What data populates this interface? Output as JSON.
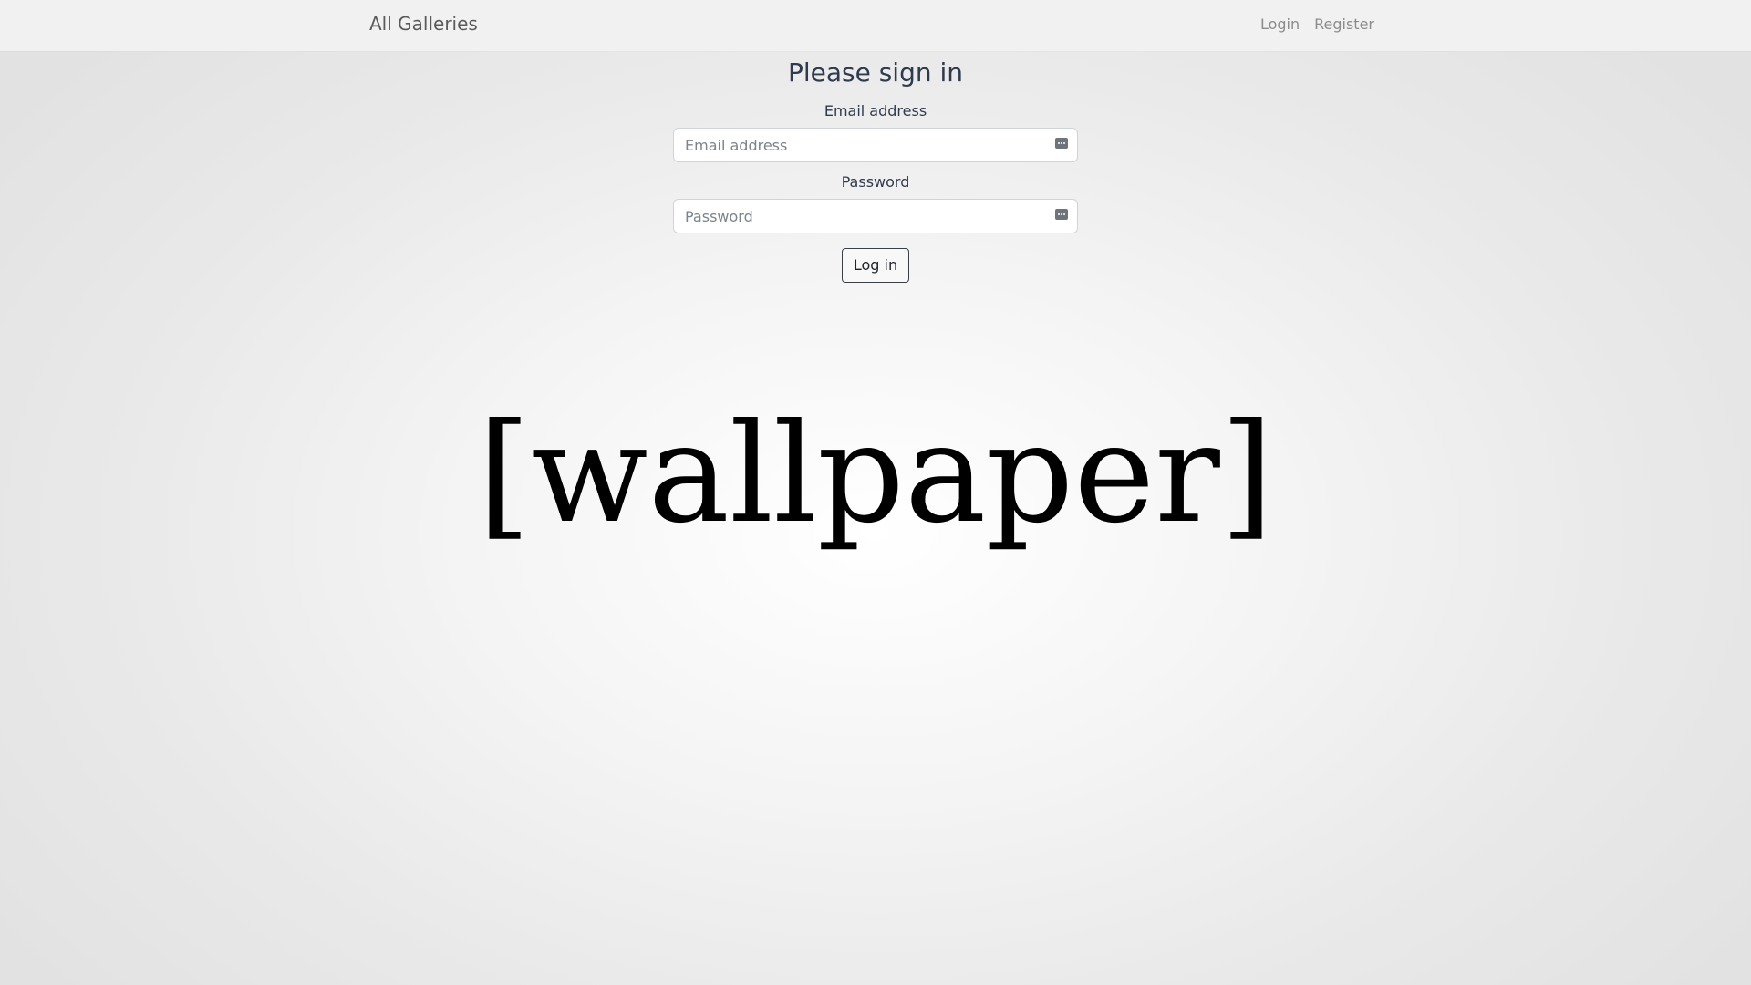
{
  "navbar": {
    "brand": "All Galleries",
    "links": [
      {
        "label": "Login"
      },
      {
        "label": "Register"
      }
    ]
  },
  "form": {
    "title": "Please sign in",
    "email": {
      "label": "Email address",
      "placeholder": "Email address",
      "value": "",
      "icon": "key-icon"
    },
    "password": {
      "label": "Password",
      "placeholder": "Password",
      "value": "",
      "icon": "key-icon"
    },
    "submit_label": "Log in"
  },
  "background": {
    "text": "[wallpaper]"
  },
  "colors": {
    "navbar_bg": "#f1f1f1",
    "heading": "#2f3b4d",
    "muted_link": "#8c8c8c"
  }
}
